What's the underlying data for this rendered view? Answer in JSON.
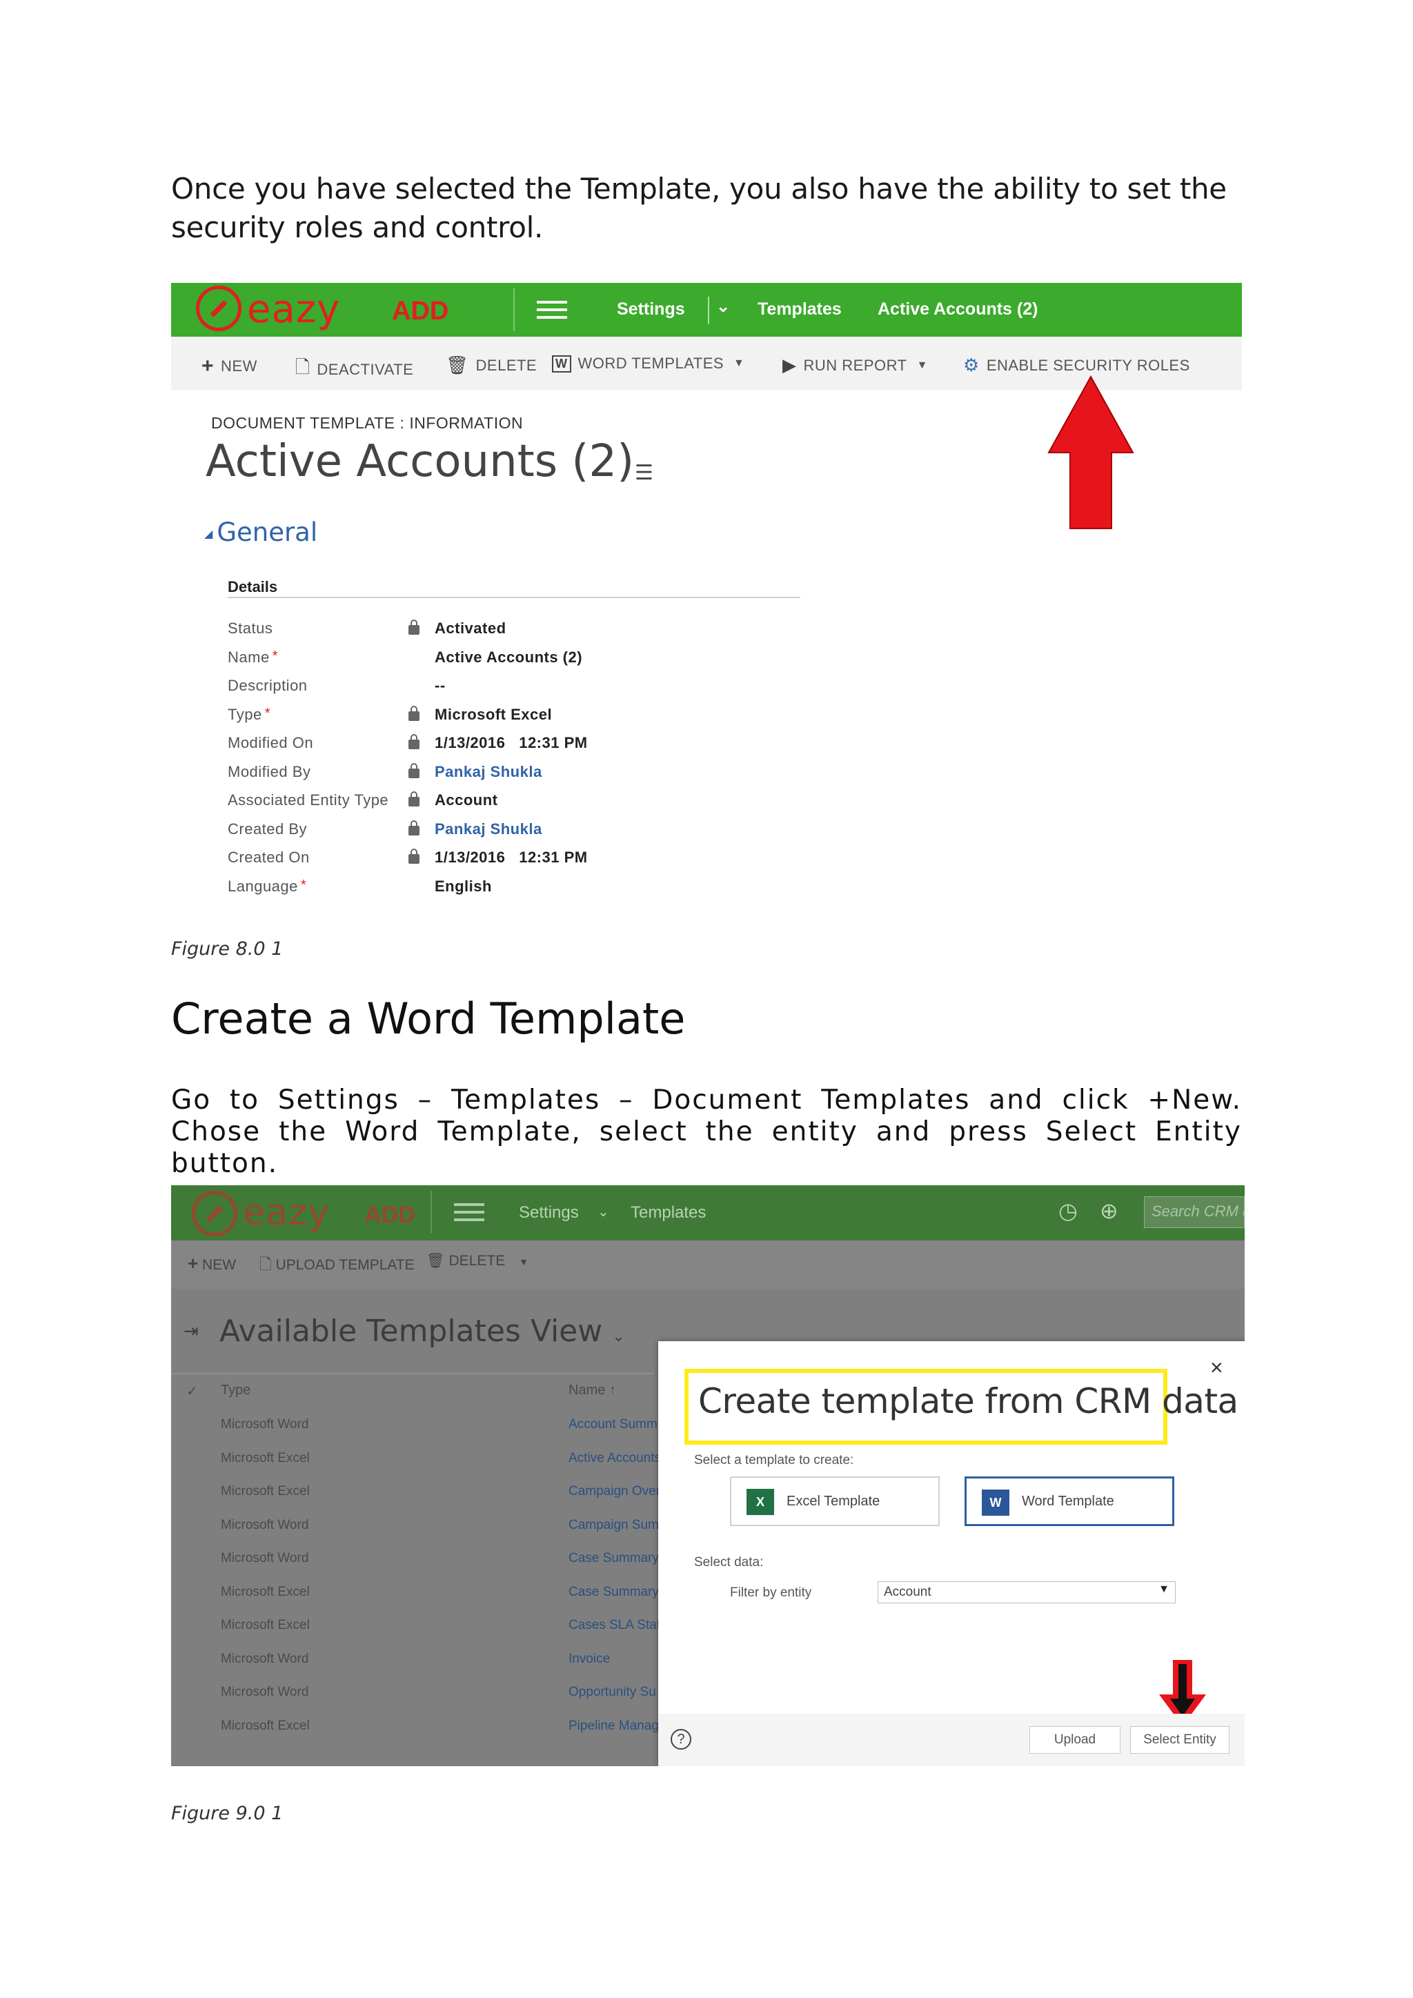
{
  "intro_text": "Once you have selected the Template, you also have the ability to set the security roles and control.",
  "figure1": {
    "caption": "Figure 8.0 1",
    "logo_text": "eazy",
    "logo_add": "ADD",
    "nav": {
      "settings": "Settings",
      "chevron": "⌄",
      "templates": "Templates",
      "active_accounts": "Active Accounts (2)"
    },
    "commands": {
      "new": "NEW",
      "deactivate": "DEACTIVATE",
      "delete": "DELETE",
      "word_templates": "WORD TEMPLATES",
      "run_report": "RUN REPORT",
      "enable_security_roles": "ENABLE SECURITY ROLES"
    },
    "record": {
      "type_label": "DOCUMENT TEMPLATE : INFORMATION",
      "title": "Active Accounts (2)",
      "section": "General",
      "details_header": "Details"
    },
    "fields": [
      {
        "label": "Status",
        "value": "Activated",
        "required": false,
        "locked": true,
        "link": false
      },
      {
        "label": "Name",
        "value": "Active Accounts (2)",
        "required": true,
        "locked": false,
        "link": false
      },
      {
        "label": "Description",
        "value": "--",
        "required": false,
        "locked": false,
        "link": false
      },
      {
        "label": "Type",
        "value": "Microsoft Excel",
        "required": true,
        "locked": true,
        "link": false
      },
      {
        "label": "Modified On",
        "value": "1/13/2016   12:31 PM",
        "required": false,
        "locked": true,
        "link": false
      },
      {
        "label": "Modified By",
        "value": "Pankaj Shukla",
        "required": false,
        "locked": true,
        "link": true
      },
      {
        "label": "Associated Entity Type",
        "value": "Account",
        "required": false,
        "locked": true,
        "link": false
      },
      {
        "label": "Created By",
        "value": "Pankaj Shukla",
        "required": false,
        "locked": true,
        "link": true
      },
      {
        "label": "Created On",
        "value": "1/13/2016   12:31 PM",
        "required": false,
        "locked": true,
        "link": false
      },
      {
        "label": "Language",
        "value": "English",
        "required": true,
        "locked": false,
        "link": false
      }
    ],
    "arrow_color": "#e8141c"
  },
  "section_heading": "Create a Word Template",
  "section_text": "Go to Settings – Templates – Document Templates and click +New. Chose the Word Template, select the entity and press Select Entity button.",
  "figure2": {
    "caption": "Figure 9.0 1",
    "nav": {
      "settings": "Settings",
      "templates": "Templates",
      "search_placeholder": "Search CRM d"
    },
    "commands": {
      "new": "NEW",
      "upload_template": "UPLOAD TEMPLATE",
      "delete": "DELETE"
    },
    "view_title": "Available Templates View",
    "columns": {
      "type": "Type",
      "name": "Name ↑"
    },
    "rows": [
      {
        "type": "Microsoft Word",
        "name": "Account Summ"
      },
      {
        "type": "Microsoft Excel",
        "name": "Active Accounts"
      },
      {
        "type": "Microsoft Excel",
        "name": "Campaign Over"
      },
      {
        "type": "Microsoft Word",
        "name": "Campaign Sum"
      },
      {
        "type": "Microsoft Word",
        "name": "Case Summary"
      },
      {
        "type": "Microsoft Excel",
        "name": "Case Summary"
      },
      {
        "type": "Microsoft Excel",
        "name": "Cases SLA Statu"
      },
      {
        "type": "Microsoft Word",
        "name": "Invoice"
      },
      {
        "type": "Microsoft Word",
        "name": "Opportunity Su"
      },
      {
        "type": "Microsoft Excel",
        "name": "Pipeline Manag"
      }
    ],
    "modal": {
      "title": "Create template from CRM data",
      "subtitle": "Select a template to create:",
      "excel_button": "Excel Template",
      "word_button": "Word Template",
      "select_data": "Select data:",
      "filter_label": "Filter by entity",
      "filter_value": "Account",
      "upload_button": "Upload",
      "select_entity_button": "Select Entity",
      "close": "×",
      "help": "?"
    },
    "highlight_color": "#ffeb1a"
  }
}
